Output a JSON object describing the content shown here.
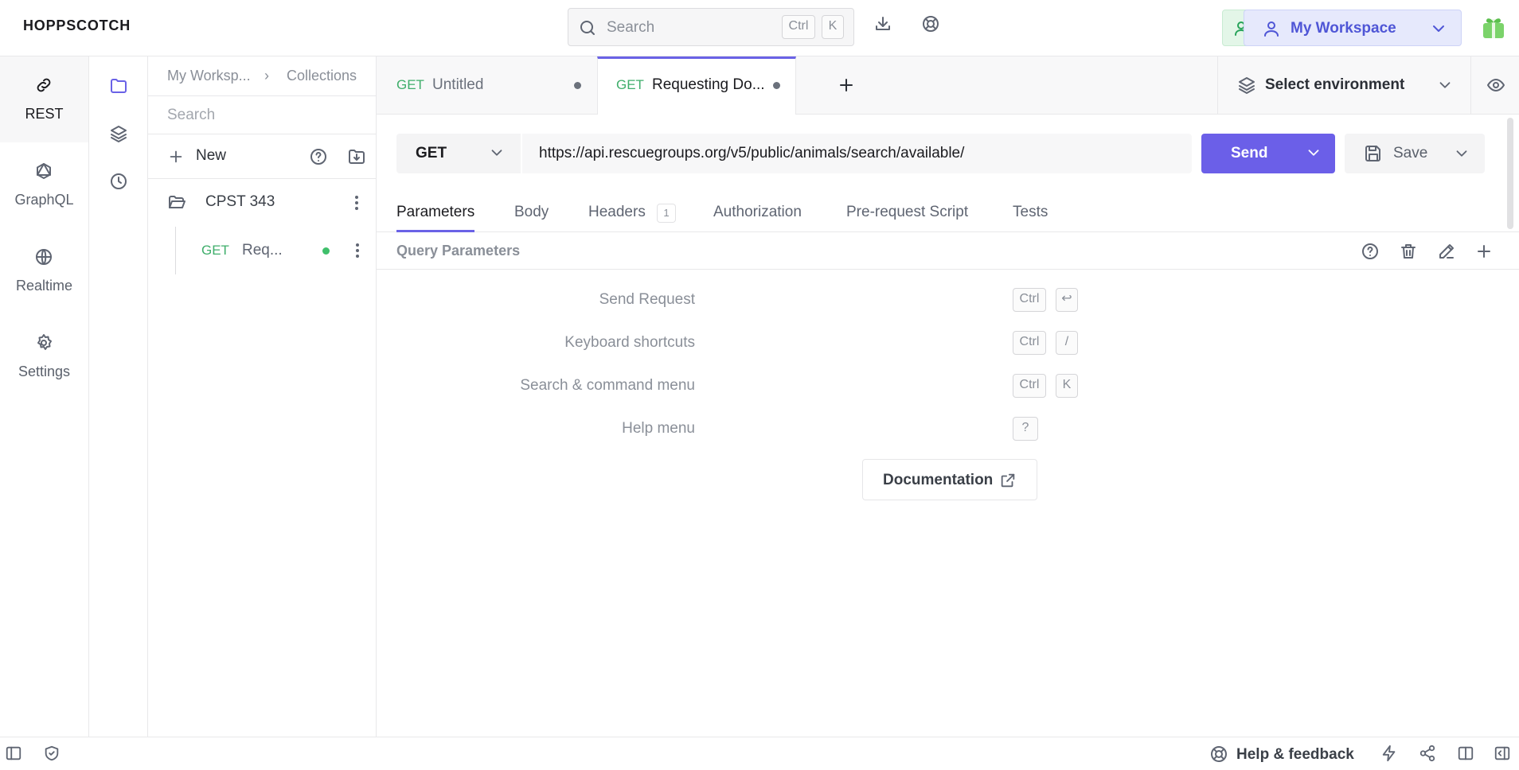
{
  "app": {
    "brand": "HOPPSCOTCH"
  },
  "header": {
    "search_placeholder": "Search",
    "search_kbd_1": "Ctrl",
    "search_kbd_2": "K",
    "workspace_label": "My Workspace",
    "icons": [
      "search-icon",
      "download-icon",
      "support-icon",
      "invite-user-icon",
      "user-icon",
      "chevron-down-icon",
      "gift-icon"
    ]
  },
  "left_nav": {
    "items": [
      {
        "label": "REST",
        "icon": "link-icon",
        "active": true
      },
      {
        "label": "GraphQL",
        "icon": "graphql-icon"
      },
      {
        "label": "Realtime",
        "icon": "globe-icon"
      },
      {
        "label": "Settings",
        "icon": "gear-icon"
      }
    ]
  },
  "collections": {
    "breadcrumb": [
      "My Worksp...",
      "Collections"
    ],
    "search_placeholder": "Search",
    "new_label": "New",
    "folder_name": "CPST 343",
    "request": {
      "method": "GET",
      "name": "Req..."
    }
  },
  "tabs": [
    {
      "method": "GET",
      "title": "Untitled"
    },
    {
      "method": "GET",
      "title": "Requesting Do...",
      "active": true
    }
  ],
  "environment": {
    "label": "Select environment"
  },
  "request": {
    "method": "GET",
    "url": "https://api.rescuegroups.org/v5/public/animals/search/available/",
    "send_label": "Send",
    "save_label": "Save"
  },
  "request_tabs": {
    "items": [
      "Parameters",
      "Body",
      "Headers",
      "Authorization",
      "Pre-request Script",
      "Tests"
    ],
    "headers_count": "1",
    "active": "Parameters"
  },
  "query_params": {
    "label": "Query Parameters"
  },
  "shortcuts": [
    {
      "label": "Send Request",
      "keys": [
        "Ctrl",
        "↩"
      ]
    },
    {
      "label": "Keyboard shortcuts",
      "keys": [
        "Ctrl",
        "/"
      ]
    },
    {
      "label": "Search & command menu",
      "keys": [
        "Ctrl",
        "K"
      ]
    },
    {
      "label": "Help menu",
      "keys": [
        "?"
      ]
    }
  ],
  "documentation_label": "Documentation",
  "footer": {
    "help_label": "Help & feedback"
  },
  "colors": {
    "accent": "#6b5fe8",
    "get_method": "#3fae6b",
    "workspace_bg": "#e6e9fc"
  }
}
